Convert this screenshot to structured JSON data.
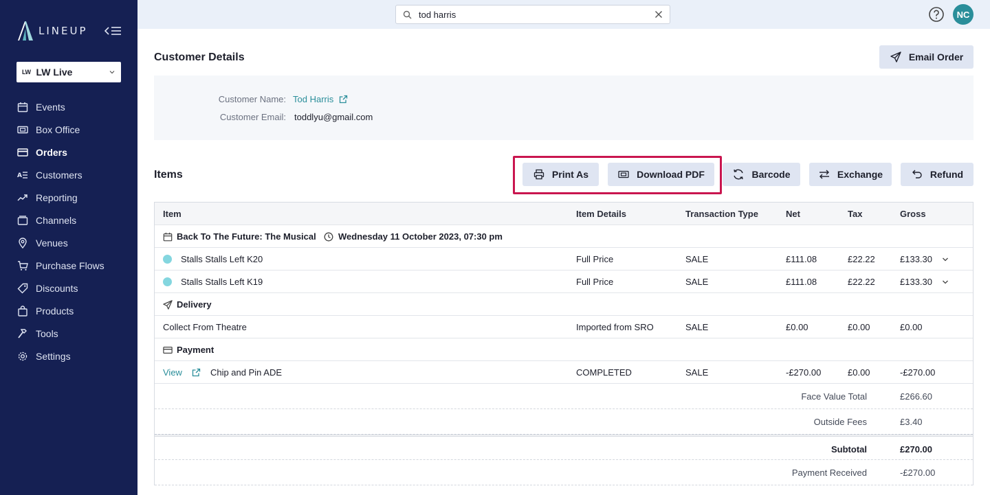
{
  "app": {
    "logo_text": "LINEUP",
    "venue": {
      "logo": "LW",
      "label": "LW Live"
    }
  },
  "sidebar": {
    "items": [
      {
        "label": "Events",
        "icon": "calendar-icon"
      },
      {
        "label": "Box Office",
        "icon": "ticket-icon"
      },
      {
        "label": "Orders",
        "icon": "credit-card-icon",
        "active": true
      },
      {
        "label": "Customers",
        "icon": "customers-list-icon"
      },
      {
        "label": "Reporting",
        "icon": "trend-line-icon"
      },
      {
        "label": "Channels",
        "icon": "channels-icon"
      },
      {
        "label": "Venues",
        "icon": "map-pin-icon"
      },
      {
        "label": "Purchase Flows",
        "icon": "cart-icon"
      },
      {
        "label": "Discounts",
        "icon": "tag-icon"
      },
      {
        "label": "Products",
        "icon": "shopping-bag-icon"
      },
      {
        "label": "Tools",
        "icon": "hammer-icon"
      },
      {
        "label": "Settings",
        "icon": "gear-icon"
      }
    ]
  },
  "header": {
    "search_value": "tod harris",
    "avatar_initials": "NC"
  },
  "customer_details": {
    "title": "Customer Details",
    "email_order_label": "Email Order",
    "name_label": "Customer Name:",
    "name_value": "Tod Harris",
    "email_label": "Customer Email:",
    "email_value": "toddlyu@gmail.com"
  },
  "items_section": {
    "title": "Items",
    "buttons": {
      "print_as": "Print As",
      "download_pdf": "Download PDF",
      "barcode": "Barcode",
      "exchange": "Exchange",
      "refund": "Refund"
    },
    "columns": {
      "item": "Item",
      "details": "Item Details",
      "type": "Transaction Type",
      "net": "Net",
      "tax": "Tax",
      "gross": "Gross"
    },
    "event": {
      "name": "Back To The Future: The Musical",
      "datetime": "Wednesday 11 October 2023, 07:30 pm"
    },
    "tickets": [
      {
        "item": "Stalls Stalls Left K20",
        "details": "Full Price",
        "type": "SALE",
        "net": "£111.08",
        "tax": "£22.22",
        "gross": "£133.30"
      },
      {
        "item": "Stalls Stalls Left K19",
        "details": "Full Price",
        "type": "SALE",
        "net": "£111.08",
        "tax": "£22.22",
        "gross": "£133.30"
      }
    ],
    "delivery": {
      "label": "Delivery",
      "item": "Collect From Theatre",
      "details": "Imported from SRO",
      "type": "SALE",
      "net": "£0.00",
      "tax": "£0.00",
      "gross": "£0.00"
    },
    "payment": {
      "label": "Payment",
      "view_label": "View",
      "item": "Chip and Pin ADE",
      "details": "COMPLETED",
      "type": "SALE",
      "net": "-£270.00",
      "tax": "£0.00",
      "gross": "-£270.00"
    },
    "totals": {
      "face_value_label": "Face Value Total",
      "face_value": "£266.60",
      "outside_fees_label": "Outside Fees",
      "outside_fees": "£3.40",
      "subtotal_label": "Subtotal",
      "subtotal": "£270.00",
      "payment_received_label": "Payment Received",
      "payment_received": "-£270.00"
    }
  },
  "colors": {
    "sidebar_bg": "#152053",
    "accent": "#2a8e9a",
    "highlight": "#c9154f",
    "button_bg": "#dfe5f2"
  }
}
